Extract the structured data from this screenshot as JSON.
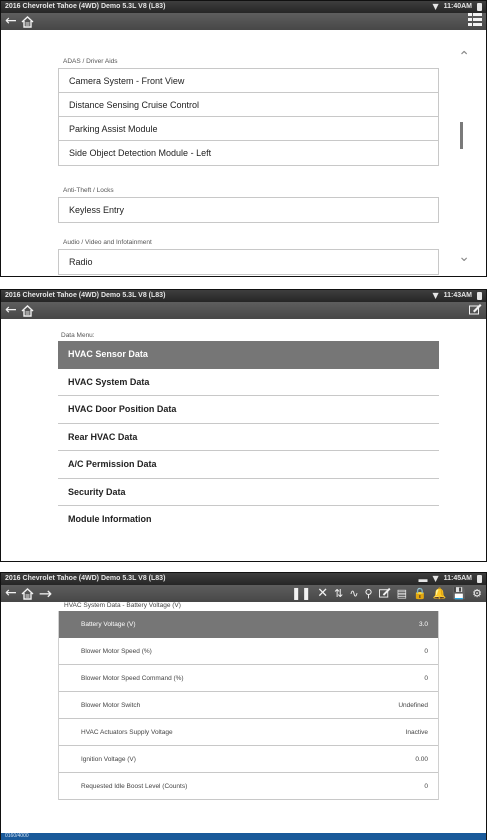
{
  "panel1": {
    "status": {
      "vehicle": "2016 Chevrolet Tahoe (4WD) Demo 5.3L V8 (L83)",
      "time": "11:40AM"
    },
    "sections": [
      {
        "title": "ADAS / Driver Aids",
        "items": [
          "Camera System - Front View",
          "Distance Sensing Cruise Control",
          "Parking Assist Module",
          "Side Object Detection Module - Left"
        ]
      },
      {
        "title": "Anti-Theft / Locks",
        "items": [
          "Keyless Entry"
        ]
      },
      {
        "title": "Audio / Video and Infotainment",
        "items": [
          "Radio"
        ]
      }
    ]
  },
  "panel2": {
    "status": {
      "vehicle": "2016 Chevrolet Tahoe (4WD) Demo 5.3L V8 (L83)",
      "time": "11:43AM"
    },
    "menu_label": "Data Menu:",
    "menu": [
      "HVAC Sensor Data",
      "HVAC System Data",
      "HVAC Door Position Data",
      "Rear HVAC Data",
      "A/C Permission Data",
      "Security Data",
      "Module Information"
    ],
    "selected_index": 0
  },
  "panel3": {
    "status": {
      "vehicle": "2016 Chevrolet Tahoe (4WD) Demo 5.3L V8 (L83)",
      "time": "11:45AM"
    },
    "table_title": "HVAC System Data - Battery Voltage (V)",
    "rows": [
      {
        "name": "Battery Voltage (V)",
        "value": "3.0"
      },
      {
        "name": "Blower Motor Speed (%)",
        "value": "0"
      },
      {
        "name": "Blower Motor Speed Command (%)",
        "value": "0"
      },
      {
        "name": "Blower Motor Switch",
        "value": "Undefined"
      },
      {
        "name": "HVAC Actuators Supply Voltage",
        "value": "Inactive"
      },
      {
        "name": "Ignition Voltage (V)",
        "value": "0.00"
      },
      {
        "name": "Requested Idle Boost Level (Counts)",
        "value": "0"
      }
    ],
    "selected_index": 0,
    "frame_counter": "0160/4000"
  },
  "icons": [
    "back-arrow-icon",
    "home-icon",
    "forward-arrow-icon",
    "wifi-icon",
    "battery-icon",
    "chevron-up-icon",
    "chevron-down-icon",
    "grid-view-icon",
    "pause-icon",
    "clear-icon",
    "sort-icon",
    "graph-icon",
    "zoom-icon",
    "edit-icon",
    "filter-icon",
    "lock-icon",
    "alert-icon",
    "save-icon",
    "settings-icon"
  ],
  "colors": {
    "statusbar": "#2e2e2e",
    "toolbar": "#505050",
    "selected_row": "#767676",
    "bottom_bar": "#1a5a9a"
  }
}
